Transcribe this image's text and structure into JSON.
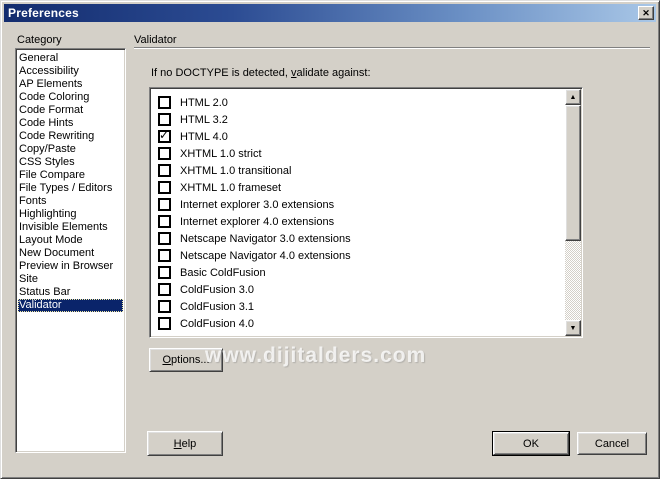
{
  "window": {
    "title": "Preferences",
    "close_icon": "✕"
  },
  "category": {
    "label": "Category",
    "items": [
      {
        "label": "General"
      },
      {
        "label": "Accessibility"
      },
      {
        "label": "AP Elements"
      },
      {
        "label": "Code Coloring"
      },
      {
        "label": "Code Format"
      },
      {
        "label": "Code Hints"
      },
      {
        "label": "Code Rewriting"
      },
      {
        "label": "Copy/Paste"
      },
      {
        "label": "CSS Styles"
      },
      {
        "label": "File Compare"
      },
      {
        "label": "File Types / Editors"
      },
      {
        "label": "Fonts"
      },
      {
        "label": "Highlighting"
      },
      {
        "label": "Invisible Elements"
      },
      {
        "label": "Layout Mode"
      },
      {
        "label": "New Document"
      },
      {
        "label": "Preview in Browser"
      },
      {
        "label": "Site"
      },
      {
        "label": "Status Bar"
      },
      {
        "label": "Validator",
        "selected": true
      }
    ]
  },
  "panel": {
    "title": "Validator",
    "doctype_label": {
      "pre": "If no DOCTYPE is detected, ",
      "key": "v",
      "post": "alidate against:"
    },
    "checklist": [
      {
        "label": "HTML 2.0",
        "checked": false
      },
      {
        "label": "HTML 3.2",
        "checked": false
      },
      {
        "label": "HTML 4.0",
        "checked": true
      },
      {
        "label": "XHTML 1.0 strict",
        "checked": false
      },
      {
        "label": "XHTML 1.0 transitional",
        "checked": false
      },
      {
        "label": "XHTML 1.0 frameset",
        "checked": false
      },
      {
        "label": "Internet explorer 3.0 extensions",
        "checked": false
      },
      {
        "label": "Internet explorer 4.0 extensions",
        "checked": false
      },
      {
        "label": "Netscape Navigator 3.0 extensions",
        "checked": false
      },
      {
        "label": "Netscape Navigator 4.0 extensions",
        "checked": false
      },
      {
        "label": "Basic ColdFusion",
        "checked": false
      },
      {
        "label": "ColdFusion 3.0",
        "checked": false
      },
      {
        "label": "ColdFusion 3.1",
        "checked": false
      },
      {
        "label": "ColdFusion 4.0",
        "checked": false
      },
      {
        "label": "",
        "checked": false,
        "partial": true
      }
    ],
    "options_button": {
      "key": "O",
      "post": "ptions..."
    },
    "scrollbar": {
      "up_icon": "▲",
      "down_icon": "▼"
    }
  },
  "watermark": "www.dijitalders.com",
  "footer": {
    "help_button": {
      "key": "H",
      "post": "elp"
    },
    "ok_button": "OK",
    "cancel_button": "Cancel"
  },
  "colors": {
    "dialog_bg": "#d4d0c8",
    "titlebar_gradient_start": "#132c6e",
    "titlebar_gradient_end": "#a9c7e7",
    "selection_bg": "#0a246a",
    "selection_text": "#ffffff",
    "list_bg": "#ffffff"
  }
}
